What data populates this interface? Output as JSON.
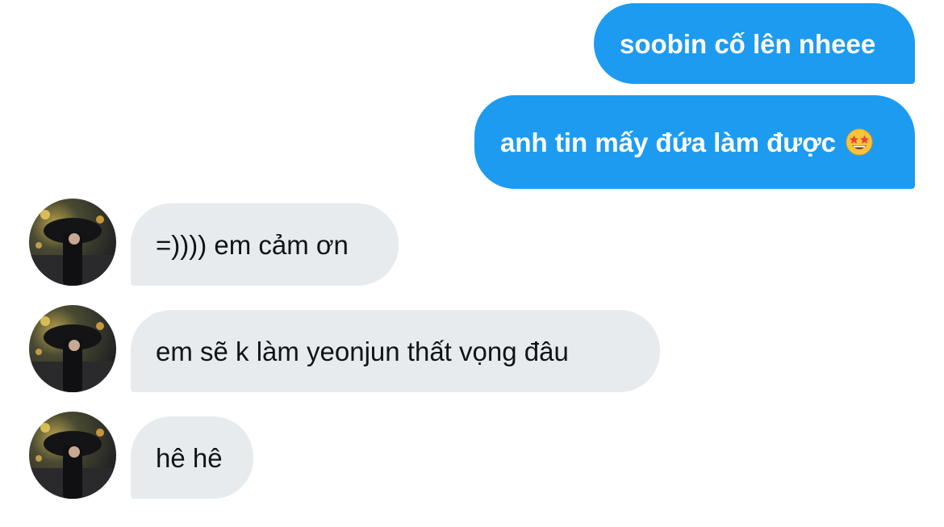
{
  "conversation": {
    "messages": [
      {
        "direction": "sent",
        "text": "soobin cố lên nheee"
      },
      {
        "direction": "sent",
        "text": "anh tin mấy đứa làm được",
        "emoji": "star-struck-emoji-icon"
      },
      {
        "direction": "received",
        "text": "=)))) em cảm ơn",
        "avatar": "avatar-photo-umbrella"
      },
      {
        "direction": "received",
        "text": "em sẽ k làm yeonjun thất vọng đâu",
        "avatar": "avatar-photo-umbrella"
      },
      {
        "direction": "received",
        "text": "hê hê",
        "avatar": "avatar-photo-umbrella"
      }
    ]
  },
  "colors": {
    "sent_bubble": "#1d9bf0",
    "sent_text": "#ffffff",
    "received_bubble": "#e7ebee",
    "received_text": "#0f1419",
    "background": "#ffffff"
  }
}
